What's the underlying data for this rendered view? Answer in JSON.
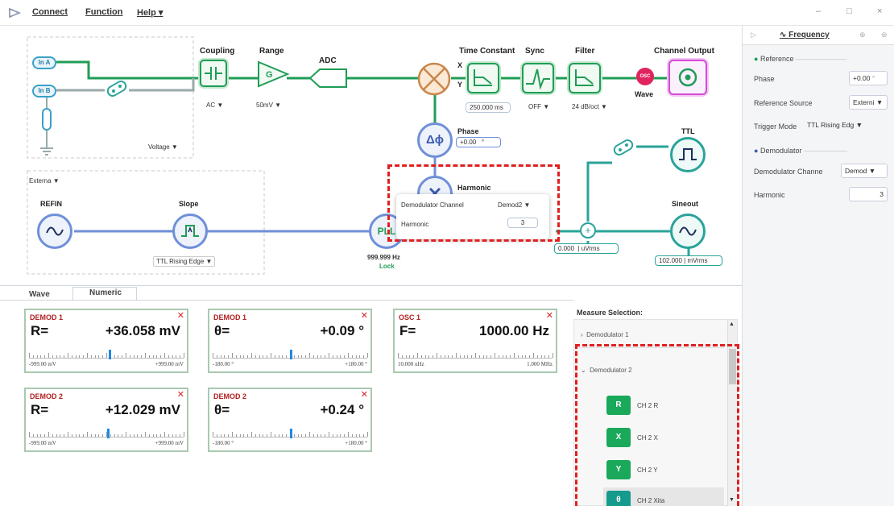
{
  "menu": {
    "connect": "Connect",
    "function": "Function",
    "help": "Help ▾"
  },
  "window_controls": {
    "minimize": "–",
    "maximize": "□",
    "close": "×"
  },
  "diagram": {
    "inputs": {
      "in_a": "In A",
      "in_b": "In B",
      "input_mode": "Voltage"
    },
    "coupling": {
      "label": "Coupling",
      "value": "AC",
      "icon": "capacitor-icon"
    },
    "range": {
      "label": "Range",
      "value": "50mV",
      "icon_text": "G"
    },
    "adc": {
      "label": "ADC"
    },
    "mixer": {
      "x": "X",
      "y": "Y"
    },
    "time_constant": {
      "label": "Time Constant",
      "value": "250.000",
      "unit": "ms"
    },
    "sync": {
      "label": "Sync",
      "value": "OFF"
    },
    "filter": {
      "label": "Filter",
      "value": "24 dB/oct"
    },
    "channel_output": {
      "label": "Channel Output"
    },
    "osc": {
      "badge": "OSC",
      "label": "Wave"
    },
    "phase": {
      "label": "Phase",
      "symbol": "Δϕ",
      "value": "+0.00",
      "unit": "°"
    },
    "harmonic": {
      "label": "Harmonic"
    },
    "popup": {
      "channel_label": "Demodulator Channel",
      "channel_value": "Demod2",
      "harmonic_label": "Harmonic",
      "harmonic_value": "3"
    },
    "ref": {
      "source": "Externa",
      "refin": "REFIN",
      "slope": "Slope",
      "slope_value": "TTL Rising Edge"
    },
    "pll": {
      "label": "PLL",
      "freq": "999.999 Hz",
      "status": "Lock"
    },
    "ttl": {
      "label": "TTL"
    },
    "sineout": {
      "label": "Sineout",
      "value": "102.000",
      "unit": "mVrms"
    },
    "sum": {
      "value": "0.000",
      "unit": "uVrms"
    }
  },
  "bottom_tabs": [
    "Wave",
    "Numeric"
  ],
  "meters": [
    {
      "title": "DEMOD 1",
      "quantity": "R=",
      "value": "+36.058 mV",
      "min": "-999.00 mV",
      "max": "+999.00 mV",
      "level": 0.518
    },
    {
      "title": "DEMOD 1",
      "quantity": "θ=",
      "value": "+0.09 °",
      "min": "-180.00 °",
      "max": "+180.00 °",
      "level": 0.5
    },
    {
      "title": "OSC 1",
      "quantity": "F=",
      "value": "1000.00 Hz",
      "min": "10.000 uHz",
      "max": "1.000 MHz",
      "level": 0.0
    },
    {
      "title": "DEMOD 2",
      "quantity": "R=",
      "value": "+12.029 mV",
      "min": "-999.00 mV",
      "max": "+999.00 mV",
      "level": 0.506
    },
    {
      "title": "DEMOD 2",
      "quantity": "θ=",
      "value": "+0.24 °",
      "min": "-180.00 °",
      "max": "+180.00 °",
      "level": 0.5
    }
  ],
  "measure": {
    "title": "Measure Selection:",
    "group1": "Demodulator 1",
    "group2": "Demodulator 2",
    "items": [
      {
        "chip": "R",
        "label": "CH 2 R",
        "color": "#1aa85a"
      },
      {
        "chip": "X",
        "label": "CH 2 X",
        "color": "#1aa85a"
      },
      {
        "chip": "Y",
        "label": "CH 2 Y",
        "color": "#1aa85a"
      },
      {
        "chip": "θ",
        "label": "CH 2 Xita",
        "color": "#159a8c"
      }
    ]
  },
  "right_panel": {
    "tab": "Frequency",
    "reference_header": "Reference",
    "phase_label": "Phase",
    "phase_value": "+0.00",
    "phase_unit": "°",
    "ref_source_label": "Reference Source",
    "ref_source_value": "Externi",
    "trigger_label": "Trigger Mode",
    "trigger_value": "TTL Rising Edg",
    "demod_header": "Demodulator",
    "demod_channel_label": "Demodulator Channe",
    "demod_channel_value": "Demod",
    "harmonic_label": "Harmonic",
    "harmonic_value": "3"
  },
  "colors": {
    "wire_green": "#1f9d55",
    "wire_blue": "#6f8fd8",
    "wire_teal": "#2aa39a",
    "highlight": "#e02020"
  }
}
